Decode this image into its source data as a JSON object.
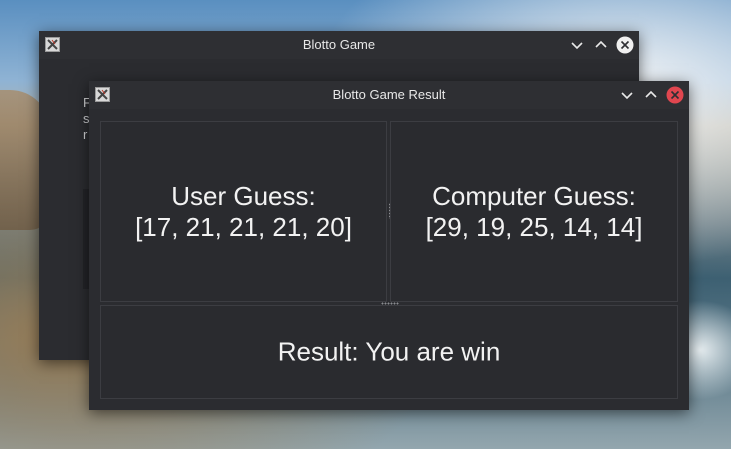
{
  "back_window": {
    "title": "Blotto Game",
    "text_fragments": [
      "F",
      "s",
      "r"
    ]
  },
  "result_window": {
    "title": "Blotto Game Result",
    "user_guess_label": "User Guess:",
    "user_guess_values": "[17, 21, 21, 21, 20]",
    "computer_guess_label": "Computer Guess:",
    "computer_guess_values": "[29, 19, 25, 14, 14]",
    "result_text": "Result: You are win"
  },
  "colors": {
    "close_button_active": "#e0464f",
    "close_button_inactive": "#f0f0f0",
    "window_background": "#2b2c30"
  },
  "icons": [
    "app-icon",
    "minimize-icon",
    "maximize-icon",
    "close-icon"
  ]
}
